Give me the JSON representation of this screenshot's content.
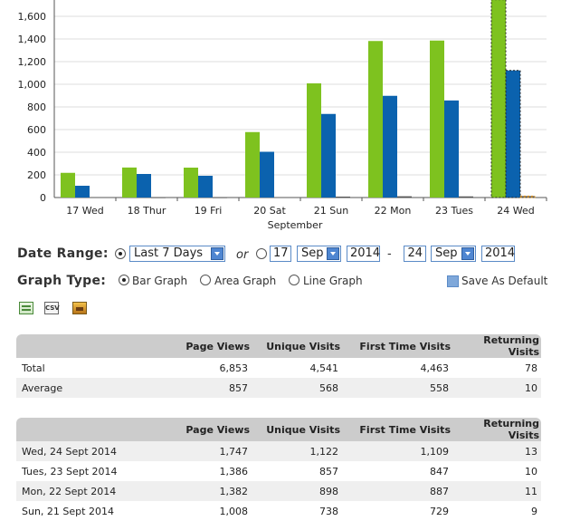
{
  "chart_data": {
    "type": "bar",
    "categories": [
      "17 Wed",
      "18 Thur",
      "19 Fri",
      "20 Sat",
      "21 Sun",
      "22 Mon",
      "23 Tues",
      "24 Wed"
    ],
    "xlabel": "September",
    "ylim": [
      0,
      1700
    ],
    "yticks": [
      0,
      200,
      400,
      600,
      800,
      1000,
      1200,
      1400,
      1600
    ],
    "ytick_labels": [
      "0",
      "200",
      "400",
      "600",
      "800",
      "1,000",
      "1,200",
      "1,400",
      "1,600"
    ],
    "grid": true,
    "series": [
      {
        "values": [
          218,
          265,
          264,
          578,
          1008,
          1382,
          1386,
          1747
        ],
        "color": "#7ec21f"
      },
      {
        "values": [
          104,
          208,
          192,
          404,
          738,
          898,
          857,
          1122
        ],
        "color": "#0b62ae"
      },
      {
        "values": [
          4,
          3,
          3,
          4,
          8,
          11,
          10,
          13
        ],
        "color": "#555555"
      }
    ],
    "highlighted_category": "24 Wed"
  },
  "controls": {
    "date_range_label": "Date Range:",
    "preset_value": "Last 7 Days",
    "or_text": "or",
    "from_day": "17",
    "from_month": "Sep",
    "from_year": "2014",
    "dash": "-",
    "to_day": "24",
    "to_month": "Sep",
    "to_year": "2014",
    "graph_type_label": "Graph Type:",
    "bar_graph": "Bar Graph",
    "area_graph": "Area Graph",
    "line_graph": "Line Graph",
    "save_default": "Save As Default"
  },
  "export_icons": [
    "excel-export-icon",
    "csv-export-icon",
    "image-export-icon"
  ],
  "summary_table": {
    "headers": [
      "",
      "Page Views",
      "Unique Visits",
      "First Time Visits",
      "Returning Visits"
    ],
    "rows": [
      [
        "Total",
        "6,853",
        "4,541",
        "4,463",
        "78"
      ],
      [
        "Average",
        "857",
        "568",
        "558",
        "10"
      ]
    ]
  },
  "daily_table": {
    "headers": [
      "",
      "Page Views",
      "Unique Visits",
      "First Time Visits",
      "Returning Visits"
    ],
    "rows": [
      [
        "Wed, 24 Sept 2014",
        "1,747",
        "1,122",
        "1,109",
        "13"
      ],
      [
        "Tues, 23 Sept 2014",
        "1,386",
        "857",
        "847",
        "10"
      ],
      [
        "Mon, 22 Sept 2014",
        "1,382",
        "898",
        "887",
        "11"
      ],
      [
        "Sun, 21 Sept 2014",
        "1,008",
        "738",
        "729",
        "9"
      ]
    ]
  }
}
